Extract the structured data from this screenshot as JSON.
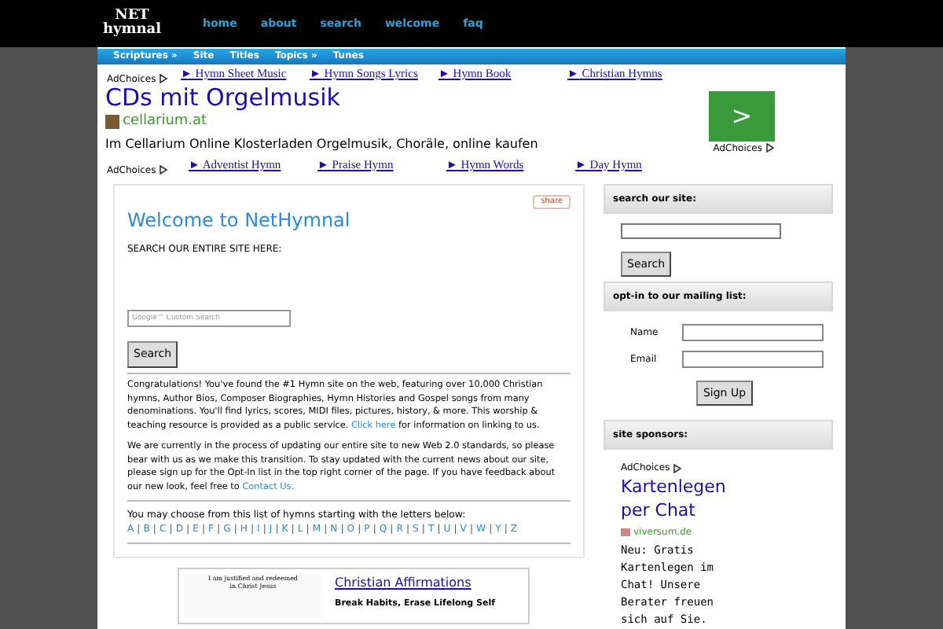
{
  "logo": {
    "line_1": "NET",
    "line_2": "hymnal"
  },
  "top_nav": [
    {
      "label": "home"
    },
    {
      "label": "about"
    },
    {
      "label": "search"
    },
    {
      "label": "welcome"
    },
    {
      "label": "faq"
    }
  ],
  "sub_nav": [
    {
      "label": "Scriptures »"
    },
    {
      "label": "Site"
    },
    {
      "label": "Titles"
    },
    {
      "label": "Topics »"
    },
    {
      "label": "Tunes"
    }
  ],
  "ad_top": {
    "adchoices": "AdChoices",
    "links": [
      "► Hymn Sheet Music",
      "► Hymn Songs Lyrics",
      "► Hymn Book",
      "► Christian Hymns"
    ],
    "headline": "CDs mit Orgelmusik",
    "domain": "cellarium.at",
    "text": "Im Cellarium Online Klosterladen Orgelmusik, Choräle, online kaufen",
    "arrow": ">",
    "adchoices_2": "AdChoices"
  },
  "ad_bottom": {
    "adchoices": "AdChoices",
    "links": [
      "► Adventist Hymn",
      "► Praise Hymn",
      "► Hymn Words",
      "► Day Hymn"
    ]
  },
  "main": {
    "share": "share",
    "title": "Welcome to NetHymnal",
    "search_label": "SEARCH OUR ENTIRE SITE HERE:",
    "search_placeholder": "Google™ Custom Search",
    "search_button": "Search",
    "paragraph_1": "Congratulations! You've found the #1 Hymn site on the web, featuring over 10,000 Christian hymns, Author Bios, Composer Biographies, Hymn Histories and Gospel songs from many denominations. You'll find lyrics, scores, MIDI files, pictures, history, & more.  This worship & teaching resource is provided as a public service.",
    "link_1": "Click here",
    "paragraph_1_end": "for information on linking to us.",
    "paragraph_2": "We are currently in the process of updating our entire site to new Web 2.0 standards, so please bear with us as we make this transition. To stay updated with the current news about our site, please sign up for the Opt-In list in the top right corner of the page. If you have feedback about our new look, feel free to",
    "link_2": "Contact Us.",
    "letters_intro": "You may choose from this list of hymns starting with the letters below:",
    "letter_separator": "|",
    "letters": [
      "A",
      "B",
      "C",
      "D",
      "E",
      "F",
      "G",
      "H",
      "I",
      "J",
      "K",
      "L",
      "M",
      "N",
      "O",
      "P",
      "Q",
      "R",
      "S",
      "T",
      "U",
      "V",
      "W",
      "Y",
      "Z"
    ]
  },
  "promo": {
    "image_line_1": "I am justified and redeemed",
    "image_line_2": "in Christ Jesus",
    "title": "Christian Affirmations",
    "text": "Break Habits, Erase Lifelong Self"
  },
  "sidebar": {
    "search_heading": "search our site:",
    "search_button": "Search",
    "optin_heading": "opt-in to our mailing list:",
    "name_label": "Name",
    "email_label": "Email",
    "signup_button": "Sign Up",
    "sponsors_heading": "site sponsors:",
    "ad": {
      "adchoices": "AdChoices",
      "headline": "Kartenlegen per Chat",
      "domain": "viversum.de",
      "text": "Neu: Gratis Kartenlegen im Chat! Unsere Berater freuen sich auf Sie."
    }
  }
}
